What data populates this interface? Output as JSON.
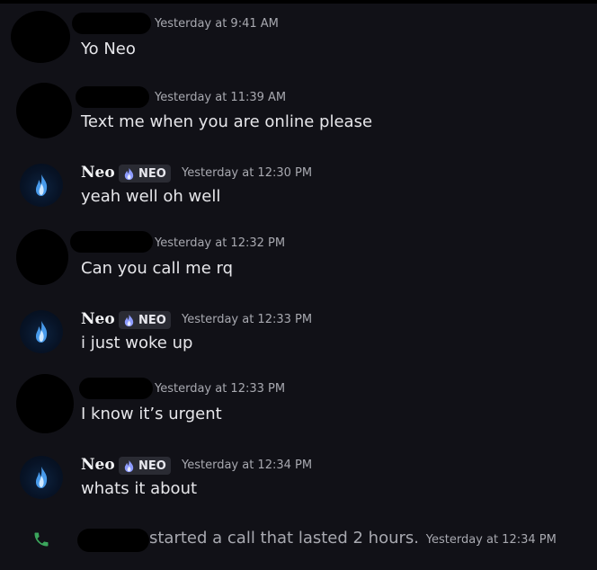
{
  "messages": [
    {
      "author": "",
      "time": "Yesterday at 9:41 AM",
      "text": "Yo Neo"
    },
    {
      "author": "",
      "time": "Yesterday at 11:39 AM",
      "text": "Text me when you are online please"
    },
    {
      "author": "Neo",
      "tag": "NEO",
      "time": "Yesterday at 12:30 PM",
      "text": "yeah well oh well"
    },
    {
      "author": "",
      "time": "Yesterday at 12:32 PM",
      "text": "Can you call me rq"
    },
    {
      "author": "Neo",
      "tag": "NEO",
      "time": "Yesterday at 12:33 PM",
      "text": "i just woke up"
    },
    {
      "author": "",
      "time": "Yesterday at 12:33 PM",
      "text": "I know it’s urgent"
    },
    {
      "author": "Neo",
      "tag": "NEO",
      "time": "Yesterday at 12:34 PM",
      "text": "whats it about"
    }
  ],
  "call": {
    "text": "started a call that lasted 2 hours.",
    "time": "Yesterday at 12:34 PM",
    "icon": "phone-icon",
    "icon_color": "#3ba55c"
  },
  "colors": {
    "background": "#111117",
    "tag_background": "#2a2b33",
    "avatar_flame": "#4fa8ff"
  }
}
